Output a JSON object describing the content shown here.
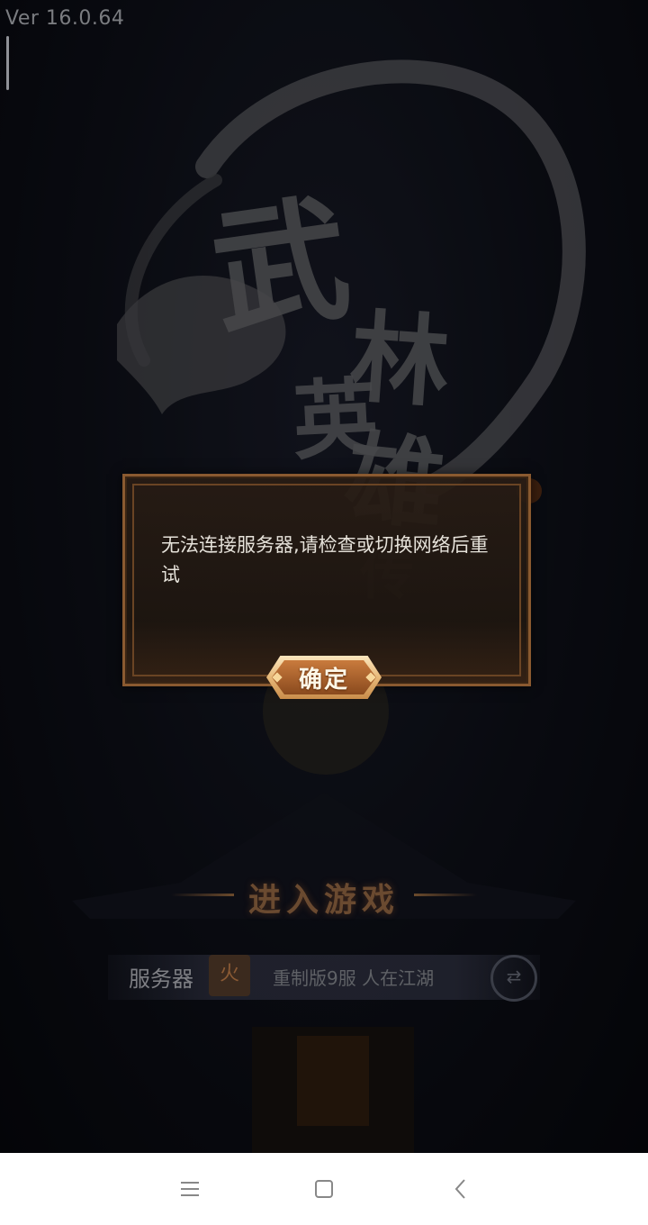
{
  "version_label": "Ver 16.0.64",
  "logo": {
    "chars": [
      "武",
      "林",
      "英",
      "雄",
      "传"
    ]
  },
  "dialog": {
    "message": "无法连接服务器,请检查或切换网络后重试",
    "confirm_label": "确定"
  },
  "lobby": {
    "enter_game_label": "进入游戏",
    "server_label": "服务器",
    "server_badge": "火",
    "server_name": "重制版9服 人在江湖"
  },
  "nav_icons": [
    "menu-icon",
    "home-square-icon",
    "back-chevron-icon"
  ]
}
